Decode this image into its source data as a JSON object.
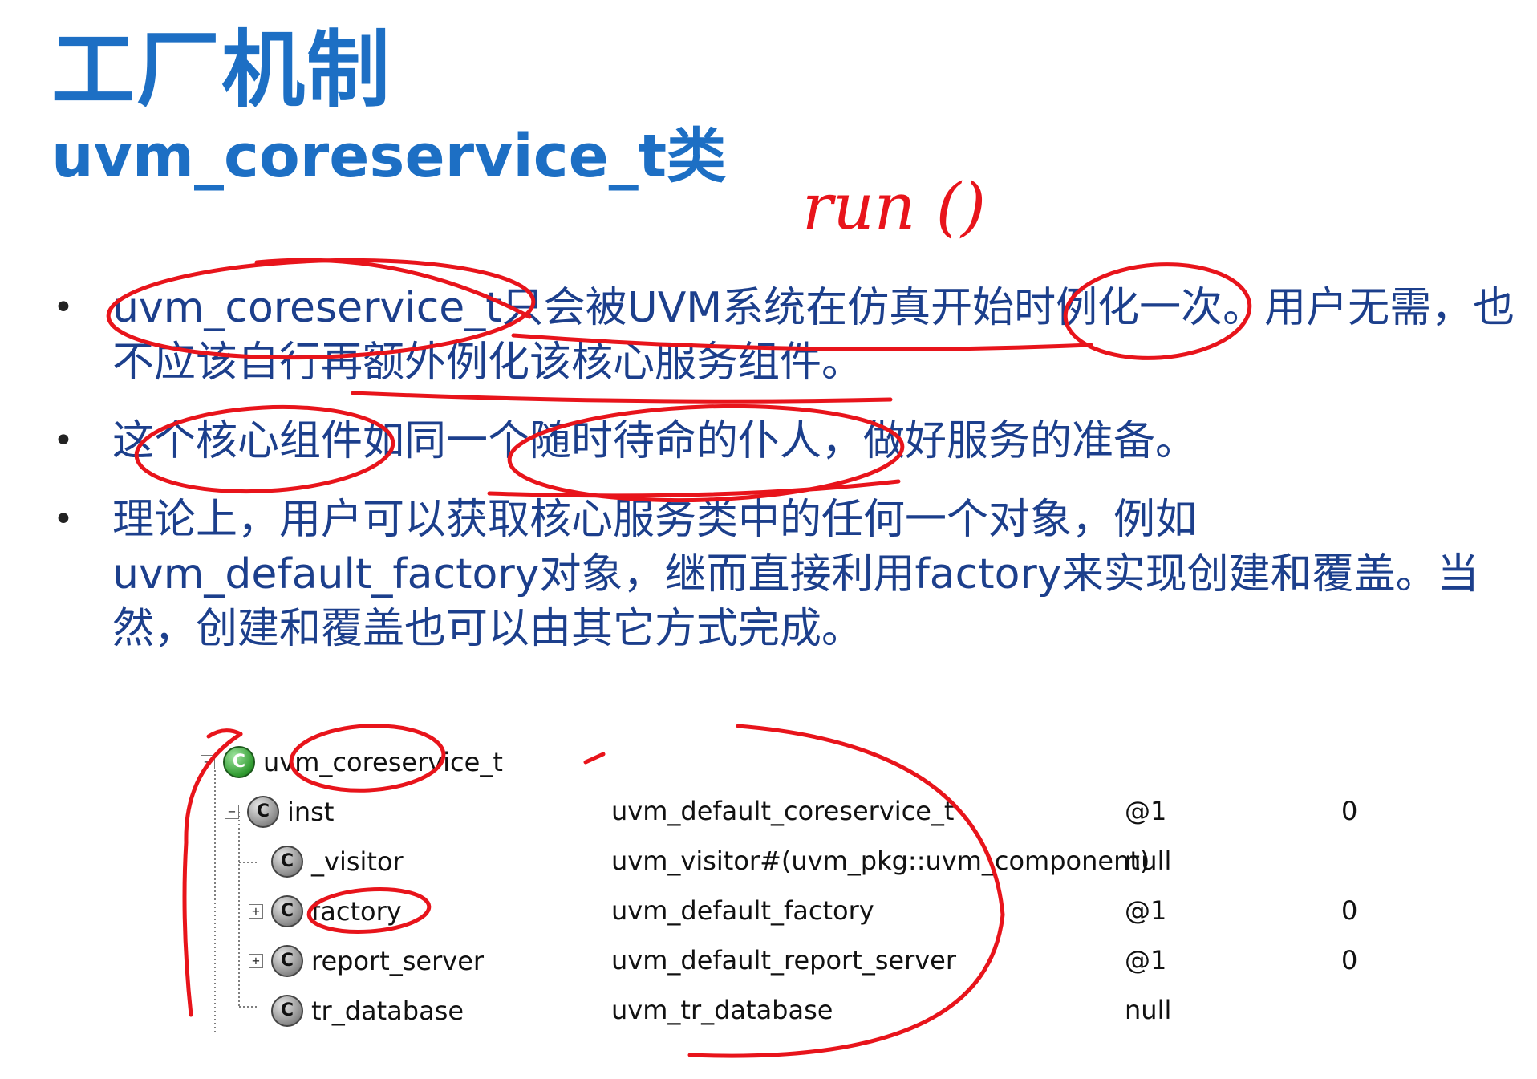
{
  "slide": {
    "title": "工厂机制",
    "subtitle": "uvm_coreservice_t类",
    "bullet_symbol": "•",
    "bullets": [
      "uvm_coreservice_t只会被UVM系统在仿真开始时例化一次。用户无需，也不应该自行再额外例化该核心服务组件。",
      "这个核心组件如同一个随时待命的仆人，做好服务的准备。",
      "理论上，用户可以获取核心服务类中的任何一个对象，例如uvm_default_factory对象，继而直接利用factory来实现创建和覆盖。当然，创建和覆盖也可以由其它方式完成。"
    ]
  },
  "tree": {
    "rows": [
      {
        "expander": "−",
        "icon": "C",
        "name": "uvm_coreservice_t",
        "type": "",
        "ref": "",
        "value": ""
      },
      {
        "expander": "−",
        "icon": "C",
        "name": "inst",
        "type": "uvm_default_coreservice_t",
        "ref": "@1",
        "value": "0"
      },
      {
        "expander": "",
        "icon": "C",
        "name": "_visitor",
        "type": "uvm_visitor#(uvm_pkg::uvm_component)",
        "ref": "null",
        "value": ""
      },
      {
        "expander": "+",
        "icon": "C",
        "name": "factory",
        "type": "uvm_default_factory",
        "ref": "@1",
        "value": "0"
      },
      {
        "expander": "+",
        "icon": "C",
        "name": "report_server",
        "type": "uvm_default_report_server",
        "ref": "@1",
        "value": "0"
      },
      {
        "expander": "",
        "icon": "C",
        "name": "tr_database",
        "type": "uvm_tr_database",
        "ref": "null",
        "value": ""
      }
    ]
  },
  "handwriting": {
    "note": "run ()",
    "ink_color": "#e8141b"
  }
}
